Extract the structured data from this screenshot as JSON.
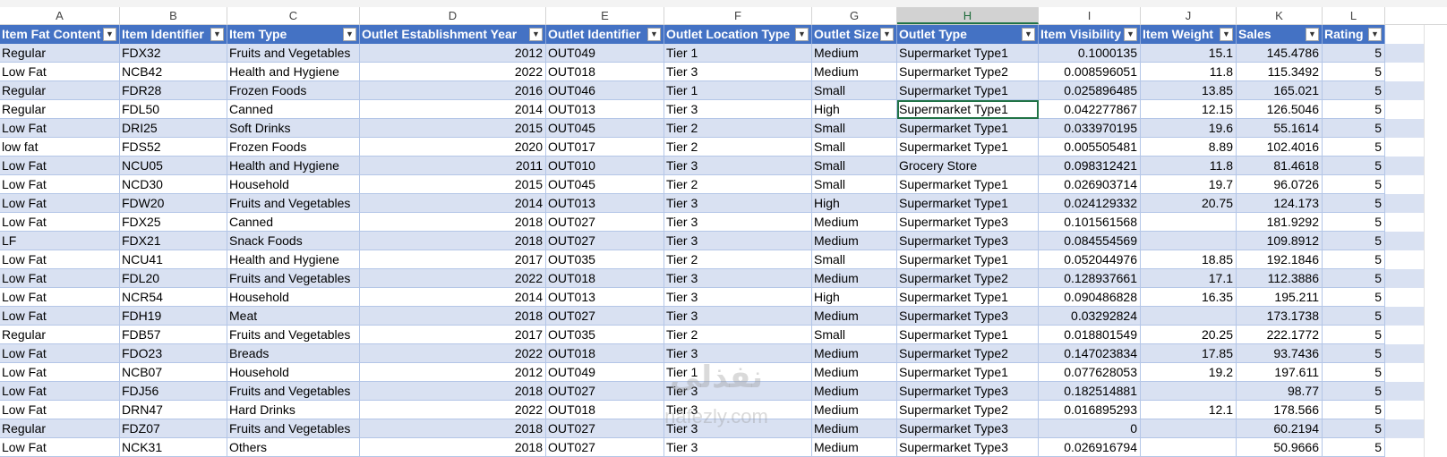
{
  "columns": [
    {
      "letter": "A",
      "header": "Item Fat Content",
      "align": "left"
    },
    {
      "letter": "B",
      "header": "Item Identifier",
      "align": "left"
    },
    {
      "letter": "C",
      "header": "Item Type",
      "align": "left"
    },
    {
      "letter": "D",
      "header": "Outlet Establishment Year",
      "align": "right"
    },
    {
      "letter": "E",
      "header": "Outlet Identifier",
      "align": "left"
    },
    {
      "letter": "F",
      "header": "Outlet Location Type",
      "align": "left"
    },
    {
      "letter": "G",
      "header": "Outlet Size",
      "align": "left"
    },
    {
      "letter": "H",
      "header": "Outlet Type",
      "align": "left"
    },
    {
      "letter": "I",
      "header": "Item Visibility",
      "align": "right"
    },
    {
      "letter": "J",
      "header": "Item Weight",
      "align": "right"
    },
    {
      "letter": "K",
      "header": "Sales",
      "align": "right"
    },
    {
      "letter": "L",
      "header": "Rating",
      "align": "right"
    }
  ],
  "filter_icon": "dropdown-arrow-icon",
  "selected_column": "H",
  "active_cell": {
    "row": 3,
    "col": 7
  },
  "rows": [
    [
      "Regular",
      "FDX32",
      "Fruits and Vegetables",
      "2012",
      "OUT049",
      "Tier 1",
      "Medium",
      "Supermarket Type1",
      "0.1000135",
      "15.1",
      "145.4786",
      "5"
    ],
    [
      "Low Fat",
      "NCB42",
      "Health and Hygiene",
      "2022",
      "OUT018",
      "Tier 3",
      "Medium",
      "Supermarket Type2",
      "0.008596051",
      "11.8",
      "115.3492",
      "5"
    ],
    [
      "Regular",
      "FDR28",
      "Frozen Foods",
      "2016",
      "OUT046",
      "Tier 1",
      "Small",
      "Supermarket Type1",
      "0.025896485",
      "13.85",
      "165.021",
      "5"
    ],
    [
      "Regular",
      "FDL50",
      "Canned",
      "2014",
      "OUT013",
      "Tier 3",
      "High",
      "Supermarket Type1",
      "0.042277867",
      "12.15",
      "126.5046",
      "5"
    ],
    [
      "Low Fat",
      "DRI25",
      "Soft Drinks",
      "2015",
      "OUT045",
      "Tier 2",
      "Small",
      "Supermarket Type1",
      "0.033970195",
      "19.6",
      "55.1614",
      "5"
    ],
    [
      "low fat",
      "FDS52",
      "Frozen Foods",
      "2020",
      "OUT017",
      "Tier 2",
      "Small",
      "Supermarket Type1",
      "0.005505481",
      "8.89",
      "102.4016",
      "5"
    ],
    [
      "Low Fat",
      "NCU05",
      "Health and Hygiene",
      "2011",
      "OUT010",
      "Tier 3",
      "Small",
      "Grocery Store",
      "0.098312421",
      "11.8",
      "81.4618",
      "5"
    ],
    [
      "Low Fat",
      "NCD30",
      "Household",
      "2015",
      "OUT045",
      "Tier 2",
      "Small",
      "Supermarket Type1",
      "0.026903714",
      "19.7",
      "96.0726",
      "5"
    ],
    [
      "Low Fat",
      "FDW20",
      "Fruits and Vegetables",
      "2014",
      "OUT013",
      "Tier 3",
      "High",
      "Supermarket Type1",
      "0.024129332",
      "20.75",
      "124.173",
      "5"
    ],
    [
      "Low Fat",
      "FDX25",
      "Canned",
      "2018",
      "OUT027",
      "Tier 3",
      "Medium",
      "Supermarket Type3",
      "0.101561568",
      "",
      "181.9292",
      "5"
    ],
    [
      "LF",
      "FDX21",
      "Snack Foods",
      "2018",
      "OUT027",
      "Tier 3",
      "Medium",
      "Supermarket Type3",
      "0.084554569",
      "",
      "109.8912",
      "5"
    ],
    [
      "Low Fat",
      "NCU41",
      "Health and Hygiene",
      "2017",
      "OUT035",
      "Tier 2",
      "Small",
      "Supermarket Type1",
      "0.052044976",
      "18.85",
      "192.1846",
      "5"
    ],
    [
      "Low Fat",
      "FDL20",
      "Fruits and Vegetables",
      "2022",
      "OUT018",
      "Tier 3",
      "Medium",
      "Supermarket Type2",
      "0.128937661",
      "17.1",
      "112.3886",
      "5"
    ],
    [
      "Low Fat",
      "NCR54",
      "Household",
      "2014",
      "OUT013",
      "Tier 3",
      "High",
      "Supermarket Type1",
      "0.090486828",
      "16.35",
      "195.211",
      "5"
    ],
    [
      "Low Fat",
      "FDH19",
      "Meat",
      "2018",
      "OUT027",
      "Tier 3",
      "Medium",
      "Supermarket Type3",
      "0.03292824",
      "",
      "173.1738",
      "5"
    ],
    [
      "Regular",
      "FDB57",
      "Fruits and Vegetables",
      "2017",
      "OUT035",
      "Tier 2",
      "Small",
      "Supermarket Type1",
      "0.018801549",
      "20.25",
      "222.1772",
      "5"
    ],
    [
      "Low Fat",
      "FDO23",
      "Breads",
      "2022",
      "OUT018",
      "Tier 3",
      "Medium",
      "Supermarket Type2",
      "0.147023834",
      "17.85",
      "93.7436",
      "5"
    ],
    [
      "Low Fat",
      "NCB07",
      "Household",
      "2012",
      "OUT049",
      "Tier 1",
      "Medium",
      "Supermarket Type1",
      "0.077628053",
      "19.2",
      "197.611",
      "5"
    ],
    [
      "Low Fat",
      "FDJ56",
      "Fruits and Vegetables",
      "2018",
      "OUT027",
      "Tier 3",
      "Medium",
      "Supermarket Type3",
      "0.182514881",
      "",
      "98.77",
      "5"
    ],
    [
      "Low Fat",
      "DRN47",
      "Hard Drinks",
      "2022",
      "OUT018",
      "Tier 3",
      "Medium",
      "Supermarket Type2",
      "0.016895293",
      "12.1",
      "178.566",
      "5"
    ],
    [
      "Regular",
      "FDZ07",
      "Fruits and Vegetables",
      "2018",
      "OUT027",
      "Tier 3",
      "Medium",
      "Supermarket Type3",
      "0",
      "",
      "60.2194",
      "5"
    ],
    [
      "Low Fat",
      "NCK31",
      "Others",
      "2018",
      "OUT027",
      "Tier 3",
      "Medium",
      "Supermarket Type3",
      "0.026916794",
      "",
      "50.9666",
      "5"
    ]
  ],
  "watermark": {
    "line1": "نفذلي",
    "line2": "nafezly.com"
  }
}
